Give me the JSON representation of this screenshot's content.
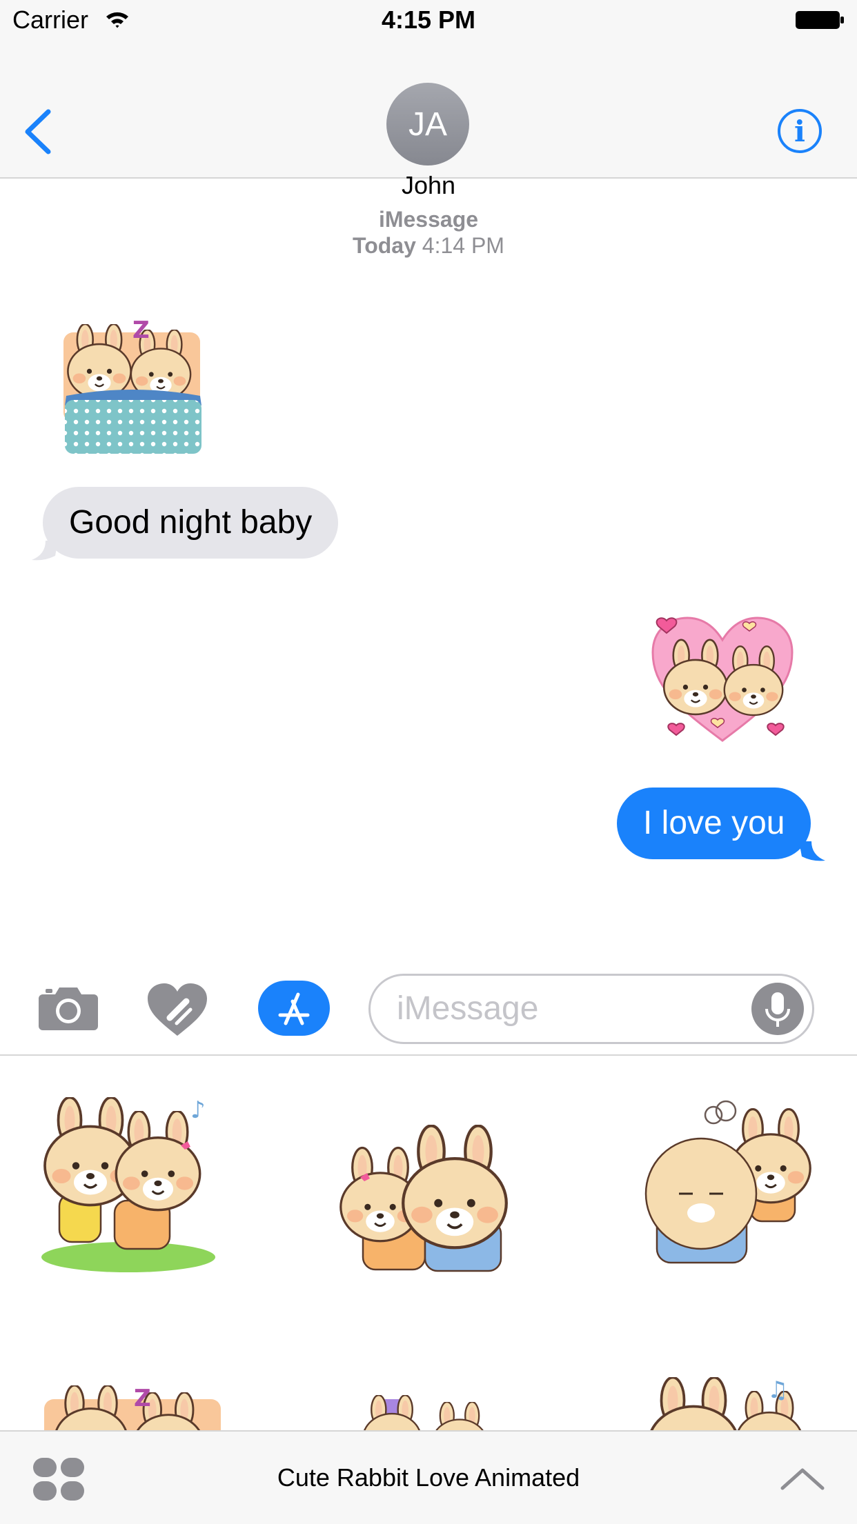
{
  "status_bar": {
    "carrier": "Carrier",
    "time": "4:15 PM"
  },
  "header": {
    "avatar_initials": "JA",
    "contact_name": "John",
    "info_icon": "i"
  },
  "conversation": {
    "service": "iMessage",
    "date_label": "Today",
    "time_label": "4:14 PM",
    "messages": [
      {
        "type": "sticker",
        "direction": "incoming",
        "sticker": "sleeping-rabbits-sticker"
      },
      {
        "type": "text",
        "direction": "incoming",
        "text": "Good night baby"
      },
      {
        "type": "sticker",
        "direction": "outgoing",
        "sticker": "heart-rabbits-sticker"
      },
      {
        "type": "text",
        "direction": "outgoing",
        "text": "I love you"
      }
    ]
  },
  "composer": {
    "placeholder": "iMessage"
  },
  "app_drawer": {
    "app_name": "Cute Rabbit Love Animated",
    "stickers": [
      "rabbits-dancing-sticker",
      "rabbits-hugging-sticker",
      "rabbits-angry-sticker",
      "sleeping-rabbits-sticker",
      "rabbits-gift-sticker",
      "rabbits-music-sticker"
    ]
  },
  "colors": {
    "accent_blue": "#1a82fb",
    "incoming_bubble": "#e5e5ea",
    "bar_background": "#f7f7f7",
    "secondary_text": "#8e8e93"
  }
}
